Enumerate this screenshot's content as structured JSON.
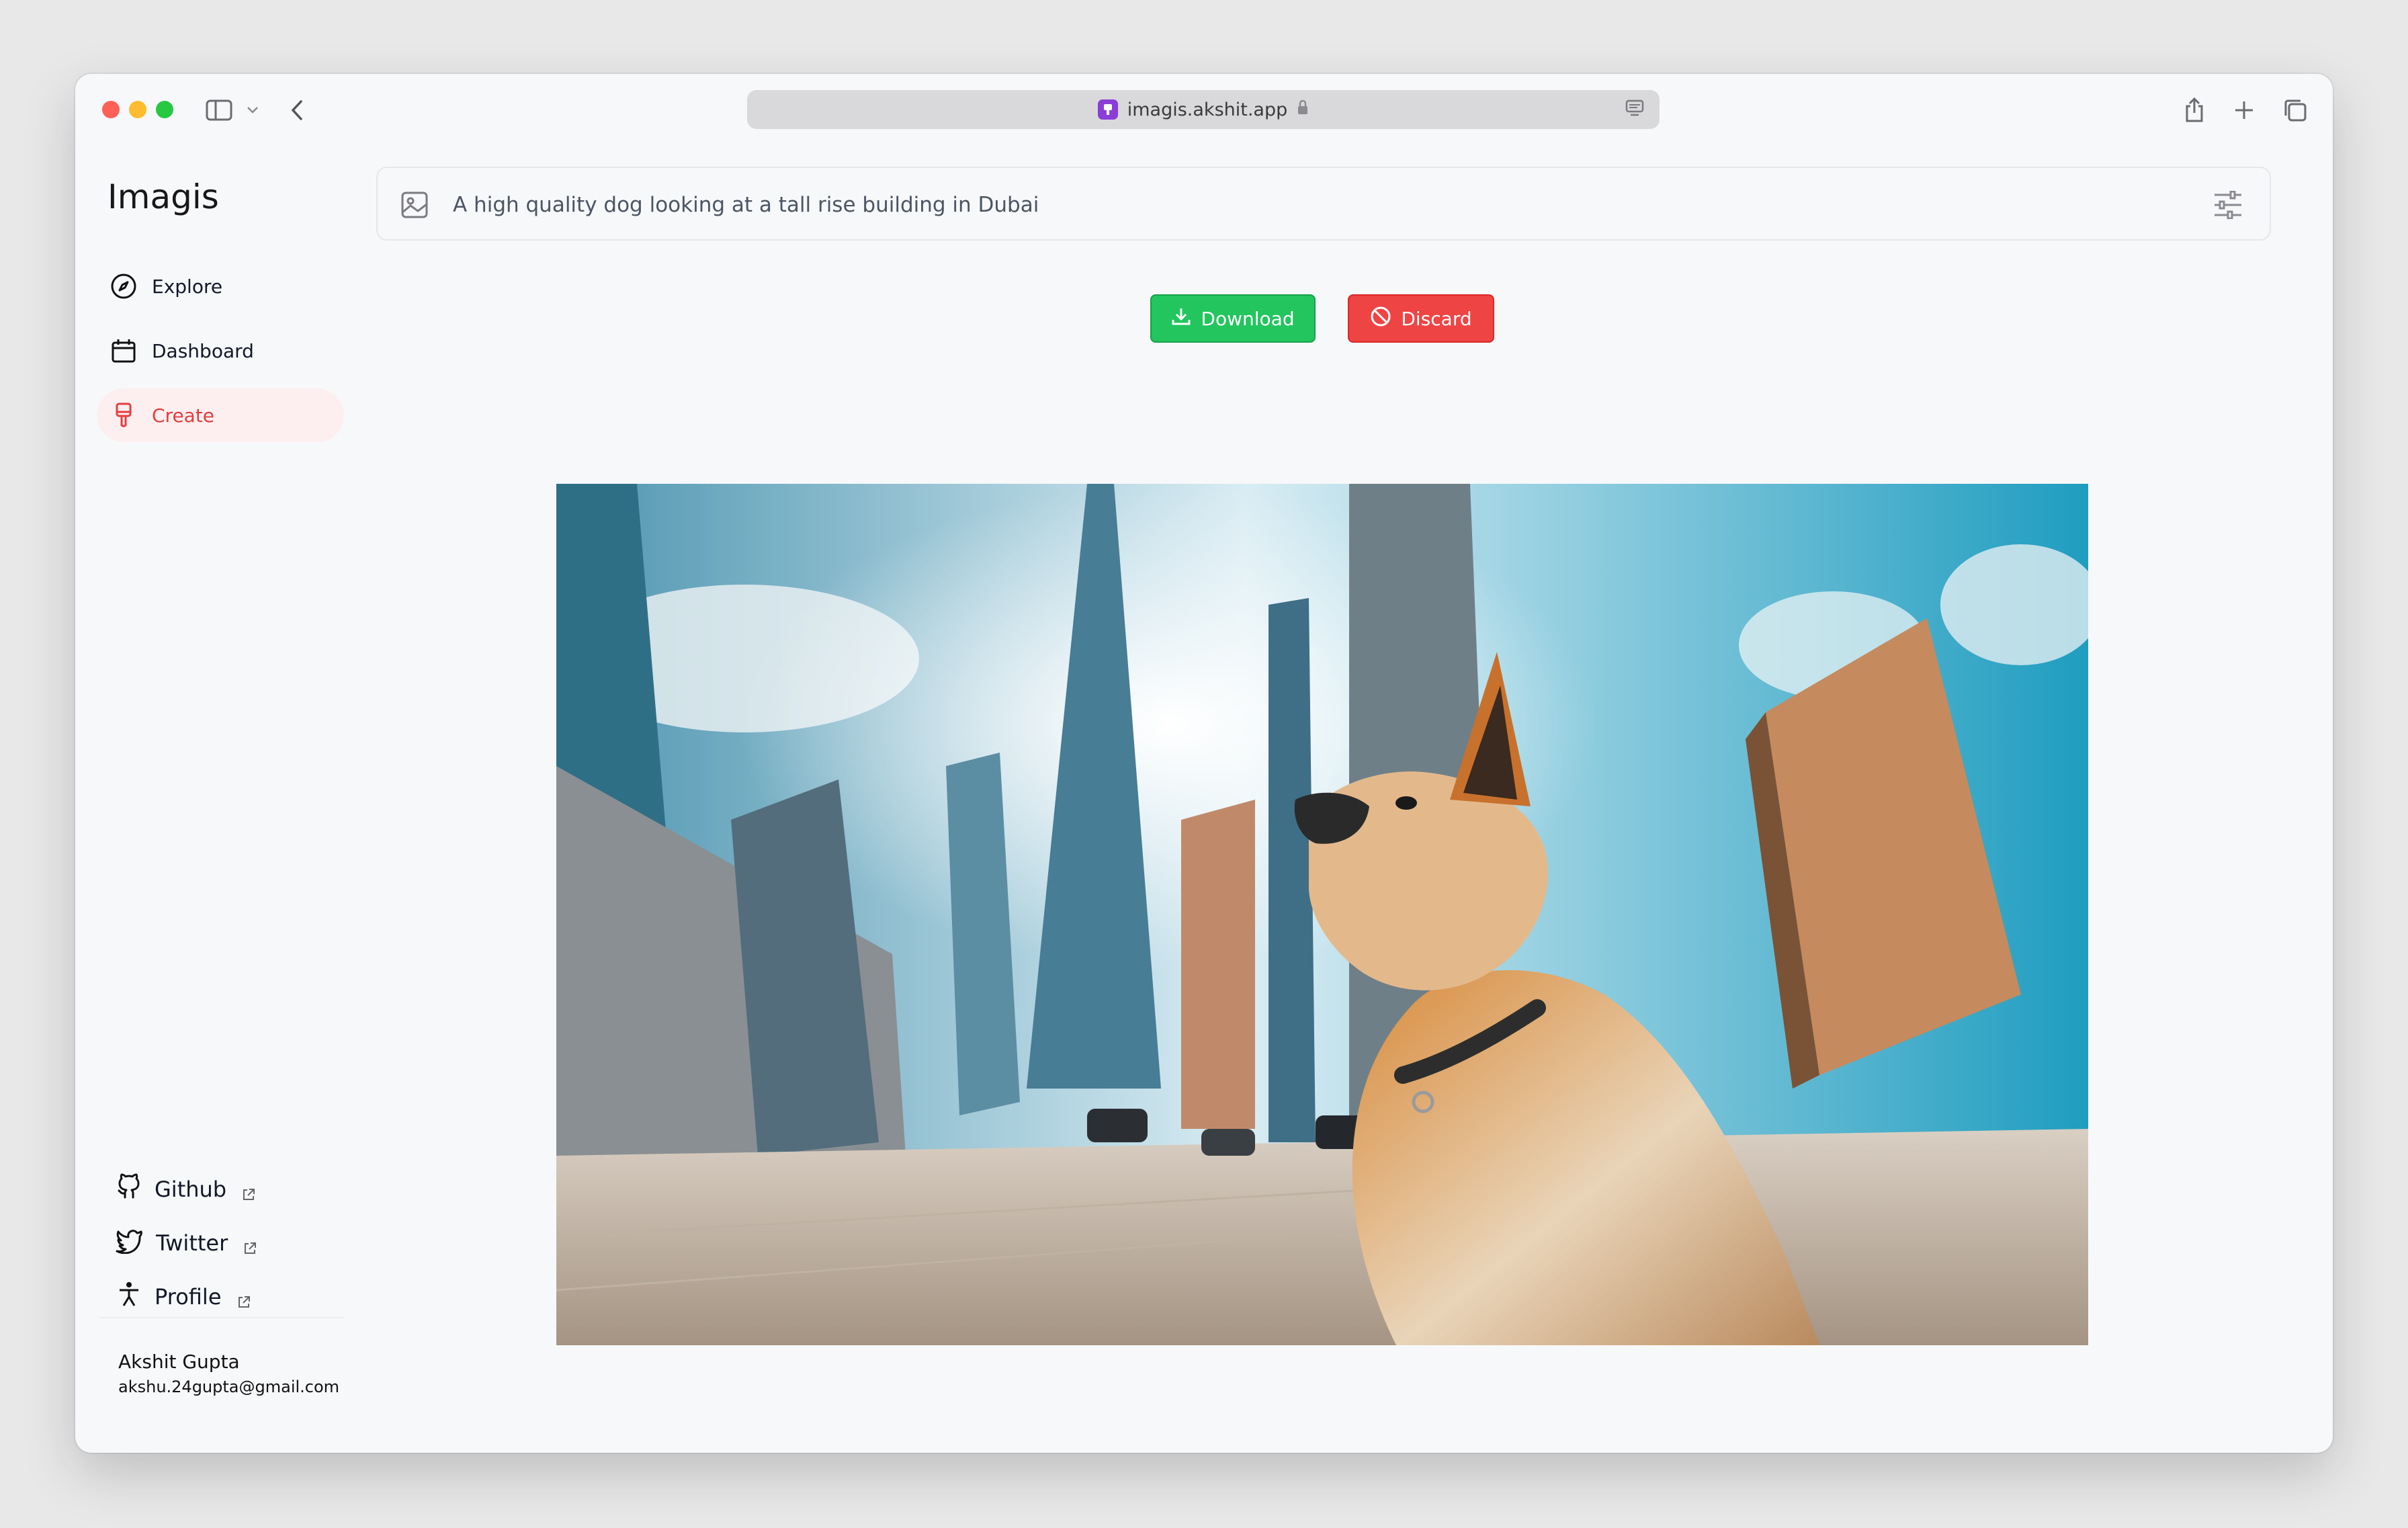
{
  "browser": {
    "url": "imagis.akshit.app",
    "icons": [
      "sidebar-toggle-icon",
      "chevron-down-icon",
      "back-arrow-icon",
      "lock-icon",
      "reader-icon",
      "share-icon",
      "plus-icon",
      "tabs-icon"
    ]
  },
  "sidebar": {
    "brand": "Imagis",
    "items": [
      {
        "label": "Explore",
        "icon": "compass-icon"
      },
      {
        "label": "Dashboard",
        "icon": "calendar-icon"
      },
      {
        "label": "Create",
        "icon": "paint-brush-icon",
        "active": true
      }
    ],
    "links": [
      {
        "label": "Github",
        "icon": "github-icon"
      },
      {
        "label": "Twitter",
        "icon": "twitter-icon"
      },
      {
        "label": "Profile",
        "icon": "person-icon"
      }
    ],
    "user": {
      "name": "Akshit Gupta",
      "email": "akshu.24gupta@gmail.com"
    }
  },
  "prompt": {
    "value": "A high quality dog looking at a tall rise building in Dubai"
  },
  "actions": {
    "download_label": "Download",
    "discard_label": "Discard"
  },
  "colors": {
    "accent_active": "#e53e3e",
    "active_bg": "#fdeff0",
    "download": "#22c55e",
    "discard": "#ef4444"
  }
}
